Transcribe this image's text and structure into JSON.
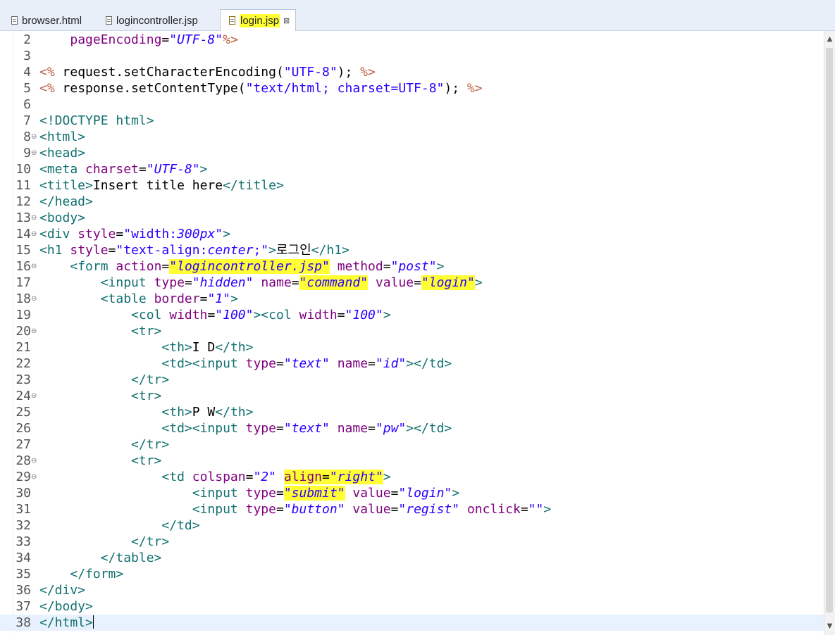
{
  "tabs": [
    {
      "label": "browser.html",
      "active": false
    },
    {
      "label": "logincontroller.jsp",
      "active": false
    },
    {
      "label": "login.jsp",
      "active": true
    }
  ],
  "tab_close_glyph": "⊠",
  "colors": {
    "tag": "#117070",
    "attribute": "#7f007f",
    "string": "#2a00ff",
    "jsp_delimiter": "#bf5f3f",
    "highlight": "#ffff33",
    "current_line": "#e8f2fe"
  },
  "editor": {
    "current_line": "38",
    "lines": [
      {
        "n": "2",
        "fold": "",
        "tokens": [
          {
            "t": "p",
            "v": "    "
          },
          {
            "t": "a",
            "v": "pageEncoding"
          },
          {
            "t": "p",
            "v": "="
          },
          {
            "t": "si",
            "v": "\"UTF-8\""
          },
          {
            "t": "d",
            "v": "%>"
          }
        ]
      },
      {
        "n": "3",
        "fold": "",
        "tokens": []
      },
      {
        "n": "4",
        "fold": "",
        "tokens": [
          {
            "t": "d",
            "v": "<%"
          },
          {
            "t": "p",
            "v": " request.setCharacterEncoding("
          },
          {
            "t": "s",
            "v": "\"UTF-8\""
          },
          {
            "t": "p",
            "v": "); "
          },
          {
            "t": "d",
            "v": "%>"
          }
        ]
      },
      {
        "n": "5",
        "fold": "",
        "tokens": [
          {
            "t": "d",
            "v": "<%"
          },
          {
            "t": "p",
            "v": " response.setContentType("
          },
          {
            "t": "s",
            "v": "\"text/html; charset=UTF-8\""
          },
          {
            "t": "p",
            "v": "); "
          },
          {
            "t": "d",
            "v": "%>"
          }
        ]
      },
      {
        "n": "6",
        "fold": "",
        "tokens": []
      },
      {
        "n": "7",
        "fold": "",
        "tokens": [
          {
            "t": "t",
            "v": "<!DOCTYPE html>"
          }
        ]
      },
      {
        "n": "8",
        "fold": "⊖",
        "tokens": [
          {
            "t": "t",
            "v": "<html>"
          }
        ]
      },
      {
        "n": "9",
        "fold": "⊖",
        "tokens": [
          {
            "t": "t",
            "v": "<head>"
          }
        ]
      },
      {
        "n": "10",
        "fold": "",
        "tokens": [
          {
            "t": "t",
            "v": "<meta"
          },
          {
            "t": "p",
            "v": " "
          },
          {
            "t": "a",
            "v": "charset"
          },
          {
            "t": "p",
            "v": "="
          },
          {
            "t": "si",
            "v": "\"UTF-8\""
          },
          {
            "t": "t",
            "v": ">"
          }
        ]
      },
      {
        "n": "11",
        "fold": "",
        "tokens": [
          {
            "t": "t",
            "v": "<title>"
          },
          {
            "t": "p",
            "v": "Insert title here"
          },
          {
            "t": "t",
            "v": "</title>"
          }
        ]
      },
      {
        "n": "12",
        "fold": "",
        "tokens": [
          {
            "t": "t",
            "v": "</head>"
          }
        ]
      },
      {
        "n": "13",
        "fold": "⊖",
        "tokens": [
          {
            "t": "t",
            "v": "<body>"
          }
        ]
      },
      {
        "n": "14",
        "fold": "⊖",
        "tokens": [
          {
            "t": "t",
            "v": "<div"
          },
          {
            "t": "p",
            "v": " "
          },
          {
            "t": "a",
            "v": "style"
          },
          {
            "t": "p",
            "v": "="
          },
          {
            "t": "s",
            "v": "\"width:"
          },
          {
            "t": "si",
            "v": "300px"
          },
          {
            "t": "s",
            "v": "\""
          },
          {
            "t": "t",
            "v": ">"
          }
        ]
      },
      {
        "n": "15",
        "fold": "",
        "tokens": [
          {
            "t": "t",
            "v": "<h1"
          },
          {
            "t": "p",
            "v": " "
          },
          {
            "t": "a",
            "v": "style"
          },
          {
            "t": "p",
            "v": "="
          },
          {
            "t": "s",
            "v": "\"text-align:"
          },
          {
            "t": "si",
            "v": "center"
          },
          {
            "t": "s",
            "v": ";\""
          },
          {
            "t": "t",
            "v": ">"
          },
          {
            "t": "p",
            "v": "로그인"
          },
          {
            "t": "t",
            "v": "</h1>"
          }
        ]
      },
      {
        "n": "16",
        "fold": "⊖",
        "tokens": [
          {
            "t": "p",
            "v": "    "
          },
          {
            "t": "t",
            "v": "<form"
          },
          {
            "t": "p",
            "v": " "
          },
          {
            "t": "a",
            "v": "action"
          },
          {
            "t": "p",
            "v": "="
          },
          {
            "t": "si",
            "v": "\"logincontroller.jsp\"",
            "hl": true
          },
          {
            "t": "p",
            "v": " "
          },
          {
            "t": "a",
            "v": "method"
          },
          {
            "t": "p",
            "v": "="
          },
          {
            "t": "si",
            "v": "\"post\""
          },
          {
            "t": "t",
            "v": ">"
          }
        ]
      },
      {
        "n": "17",
        "fold": "",
        "tokens": [
          {
            "t": "p",
            "v": "        "
          },
          {
            "t": "t",
            "v": "<input"
          },
          {
            "t": "p",
            "v": " "
          },
          {
            "t": "a",
            "v": "type"
          },
          {
            "t": "p",
            "v": "="
          },
          {
            "t": "si",
            "v": "\"hidden\""
          },
          {
            "t": "p",
            "v": " "
          },
          {
            "t": "a",
            "v": "name"
          },
          {
            "t": "p",
            "v": "="
          },
          {
            "t": "si",
            "v": "\"command\"",
            "hl": true
          },
          {
            "t": "p",
            "v": " "
          },
          {
            "t": "a",
            "v": "value"
          },
          {
            "t": "p",
            "v": "="
          },
          {
            "t": "si",
            "v": "\"login\"",
            "hl": true
          },
          {
            "t": "t",
            "v": ">"
          }
        ]
      },
      {
        "n": "18",
        "fold": "⊖",
        "tokens": [
          {
            "t": "p",
            "v": "        "
          },
          {
            "t": "t",
            "v": "<table"
          },
          {
            "t": "p",
            "v": " "
          },
          {
            "t": "a",
            "v": "border"
          },
          {
            "t": "p",
            "v": "="
          },
          {
            "t": "si",
            "v": "\"1\""
          },
          {
            "t": "t",
            "v": ">"
          }
        ]
      },
      {
        "n": "19",
        "fold": "",
        "tokens": [
          {
            "t": "p",
            "v": "            "
          },
          {
            "t": "t",
            "v": "<col"
          },
          {
            "t": "p",
            "v": " "
          },
          {
            "t": "a",
            "v": "width"
          },
          {
            "t": "p",
            "v": "="
          },
          {
            "t": "si",
            "v": "\"100\""
          },
          {
            "t": "t",
            "v": "><col"
          },
          {
            "t": "p",
            "v": " "
          },
          {
            "t": "a",
            "v": "width"
          },
          {
            "t": "p",
            "v": "="
          },
          {
            "t": "si",
            "v": "\"100\""
          },
          {
            "t": "t",
            "v": ">"
          }
        ]
      },
      {
        "n": "20",
        "fold": "⊖",
        "tokens": [
          {
            "t": "p",
            "v": "            "
          },
          {
            "t": "t",
            "v": "<tr>"
          }
        ]
      },
      {
        "n": "21",
        "fold": "",
        "tokens": [
          {
            "t": "p",
            "v": "                "
          },
          {
            "t": "t",
            "v": "<th>"
          },
          {
            "t": "p",
            "v": "I D"
          },
          {
            "t": "t",
            "v": "</th>"
          }
        ]
      },
      {
        "n": "22",
        "fold": "",
        "tokens": [
          {
            "t": "p",
            "v": "                "
          },
          {
            "t": "t",
            "v": "<td><input"
          },
          {
            "t": "p",
            "v": " "
          },
          {
            "t": "a",
            "v": "type"
          },
          {
            "t": "p",
            "v": "="
          },
          {
            "t": "si",
            "v": "\"text\""
          },
          {
            "t": "p",
            "v": " "
          },
          {
            "t": "a",
            "v": "name"
          },
          {
            "t": "p",
            "v": "="
          },
          {
            "t": "si",
            "v": "\"id\""
          },
          {
            "t": "t",
            "v": "></td>"
          }
        ]
      },
      {
        "n": "23",
        "fold": "",
        "tokens": [
          {
            "t": "p",
            "v": "            "
          },
          {
            "t": "t",
            "v": "</tr>"
          }
        ]
      },
      {
        "n": "24",
        "fold": "⊖",
        "tokens": [
          {
            "t": "p",
            "v": "            "
          },
          {
            "t": "t",
            "v": "<tr>"
          }
        ]
      },
      {
        "n": "25",
        "fold": "",
        "tokens": [
          {
            "t": "p",
            "v": "                "
          },
          {
            "t": "t",
            "v": "<th>"
          },
          {
            "t": "p",
            "v": "P W"
          },
          {
            "t": "t",
            "v": "</th>"
          }
        ]
      },
      {
        "n": "26",
        "fold": "",
        "tokens": [
          {
            "t": "p",
            "v": "                "
          },
          {
            "t": "t",
            "v": "<td><input"
          },
          {
            "t": "p",
            "v": " "
          },
          {
            "t": "a",
            "v": "type"
          },
          {
            "t": "p",
            "v": "="
          },
          {
            "t": "si",
            "v": "\"text\""
          },
          {
            "t": "p",
            "v": " "
          },
          {
            "t": "a",
            "v": "name"
          },
          {
            "t": "p",
            "v": "="
          },
          {
            "t": "si",
            "v": "\"pw\""
          },
          {
            "t": "t",
            "v": "></td>"
          }
        ]
      },
      {
        "n": "27",
        "fold": "",
        "tokens": [
          {
            "t": "p",
            "v": "            "
          },
          {
            "t": "t",
            "v": "</tr>"
          }
        ]
      },
      {
        "n": "28",
        "fold": "⊖",
        "tokens": [
          {
            "t": "p",
            "v": "            "
          },
          {
            "t": "t",
            "v": "<tr>"
          }
        ]
      },
      {
        "n": "29",
        "fold": "⊖",
        "tokens": [
          {
            "t": "p",
            "v": "                "
          },
          {
            "t": "t",
            "v": "<td"
          },
          {
            "t": "p",
            "v": " "
          },
          {
            "t": "a",
            "v": "colspan"
          },
          {
            "t": "p",
            "v": "="
          },
          {
            "t": "si",
            "v": "\"2\""
          },
          {
            "t": "p",
            "v": " "
          },
          {
            "t": "a",
            "v": "align",
            "hl": true
          },
          {
            "t": "p",
            "v": "=",
            "hl": true
          },
          {
            "t": "si",
            "v": "\"right\"",
            "hl": true
          },
          {
            "t": "t",
            "v": ">"
          }
        ]
      },
      {
        "n": "30",
        "fold": "",
        "tokens": [
          {
            "t": "p",
            "v": "                    "
          },
          {
            "t": "t",
            "v": "<input"
          },
          {
            "t": "p",
            "v": " "
          },
          {
            "t": "a",
            "v": "type"
          },
          {
            "t": "p",
            "v": "="
          },
          {
            "t": "si",
            "v": "\"submit\"",
            "hl": true
          },
          {
            "t": "p",
            "v": " "
          },
          {
            "t": "a",
            "v": "value"
          },
          {
            "t": "p",
            "v": "="
          },
          {
            "t": "si",
            "v": "\"login\""
          },
          {
            "t": "t",
            "v": ">"
          }
        ]
      },
      {
        "n": "31",
        "fold": "",
        "tokens": [
          {
            "t": "p",
            "v": "                    "
          },
          {
            "t": "t",
            "v": "<input"
          },
          {
            "t": "p",
            "v": " "
          },
          {
            "t": "a",
            "v": "type"
          },
          {
            "t": "p",
            "v": "="
          },
          {
            "t": "si",
            "v": "\"button\""
          },
          {
            "t": "p",
            "v": " "
          },
          {
            "t": "a",
            "v": "value"
          },
          {
            "t": "p",
            "v": "="
          },
          {
            "t": "si",
            "v": "\"regist\""
          },
          {
            "t": "p",
            "v": " "
          },
          {
            "t": "a",
            "v": "onclick"
          },
          {
            "t": "p",
            "v": "="
          },
          {
            "t": "s",
            "v": "\"\""
          },
          {
            "t": "t",
            "v": ">"
          }
        ]
      },
      {
        "n": "32",
        "fold": "",
        "tokens": [
          {
            "t": "p",
            "v": "                "
          },
          {
            "t": "t",
            "v": "</td>"
          }
        ]
      },
      {
        "n": "33",
        "fold": "",
        "tokens": [
          {
            "t": "p",
            "v": "            "
          },
          {
            "t": "t",
            "v": "</tr>"
          }
        ]
      },
      {
        "n": "34",
        "fold": "",
        "tokens": [
          {
            "t": "p",
            "v": "        "
          },
          {
            "t": "t",
            "v": "</table>"
          }
        ]
      },
      {
        "n": "35",
        "fold": "",
        "tokens": [
          {
            "t": "p",
            "v": "    "
          },
          {
            "t": "t",
            "v": "</form>"
          }
        ]
      },
      {
        "n": "36",
        "fold": "",
        "tokens": [
          {
            "t": "t",
            "v": "</div>"
          }
        ]
      },
      {
        "n": "37",
        "fold": "",
        "tokens": [
          {
            "t": "t",
            "v": "</body>"
          }
        ]
      },
      {
        "n": "38",
        "fold": "",
        "tokens": [
          {
            "t": "t",
            "v": "</html>"
          }
        ]
      }
    ]
  }
}
